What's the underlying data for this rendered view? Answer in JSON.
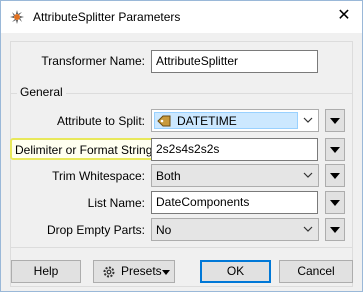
{
  "window": {
    "title": "AttributeSplitter Parameters",
    "close_glyph": "✕",
    "app_icon": "fme-workbench-icon"
  },
  "transformer": {
    "label": "Transformer Name:",
    "value": "AttributeSplitter"
  },
  "general": {
    "group_label": "General",
    "attribute_to_split": {
      "label": "Attribute to Split:",
      "value": "DATETIME",
      "icon": "attribute-tag-icon"
    },
    "delimiter": {
      "label": "Delimiter or Format String:",
      "value": "2s2s4s2s2s"
    },
    "trim_whitespace": {
      "label": "Trim Whitespace:",
      "value": "Both"
    },
    "list_name": {
      "label": "List Name:",
      "value": "DateComponents"
    },
    "drop_empty_parts": {
      "label": "Drop Empty Parts:",
      "value": "No"
    }
  },
  "buttons": {
    "help": "Help",
    "presets": "Presets",
    "ok": "OK",
    "cancel": "Cancel"
  },
  "colors": {
    "highlight_border": "#e8e85a",
    "selection_bg": "#cce8ff",
    "default_button_border": "#0078d7"
  }
}
